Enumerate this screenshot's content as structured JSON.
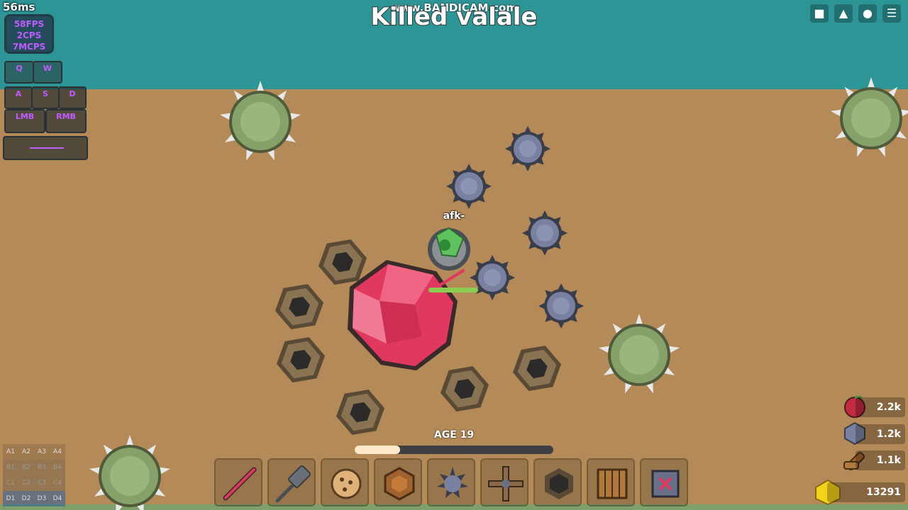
{
  "hud": {
    "ping": "56ms",
    "fps": "58FPS",
    "cps": "2CPS",
    "mcps": "7MCPS"
  },
  "keys": {
    "q": "Q",
    "w": "W",
    "a": "A",
    "s": "S",
    "d": "D",
    "lmb": "LMB",
    "rmb": "RMB"
  },
  "watermark": "www.BANDICAM.com",
  "kill_message": "Killed valale",
  "player": {
    "name": "afk-",
    "health": 1.0
  },
  "age": {
    "label": "AGE 19",
    "xp": 0.23
  },
  "top_buttons": [
    "chat-icon",
    "hat-icon",
    "clan-icon",
    "menu-icon"
  ],
  "hotbar": [
    {
      "name": "short-sword-icon"
    },
    {
      "name": "great-hammer-icon"
    },
    {
      "name": "cookie-icon"
    },
    {
      "name": "wood-wall-icon"
    },
    {
      "name": "spike-icon"
    },
    {
      "name": "windmill-icon"
    },
    {
      "name": "pit-trap-icon"
    },
    {
      "name": "platform-icon"
    },
    {
      "name": "blocker-icon"
    }
  ],
  "resources": {
    "food": "2.2k",
    "stone": "1.2k",
    "wood": "1.1k",
    "gold": "13291"
  },
  "map_grid": {
    "rows": [
      [
        "A1",
        "A2",
        "A3",
        "A4"
      ],
      [
        "B1",
        "B2",
        "B3",
        "B4"
      ],
      [
        "C1",
        "C2",
        "C3",
        "C4"
      ],
      [
        "D1",
        "D2",
        "D3",
        "D4"
      ]
    ]
  },
  "colors": {
    "water": "#2e9597",
    "ground": "#b38a58",
    "stat_text": "#c05cff",
    "health": "#8ecc51",
    "ruby": "#e0385f"
  }
}
